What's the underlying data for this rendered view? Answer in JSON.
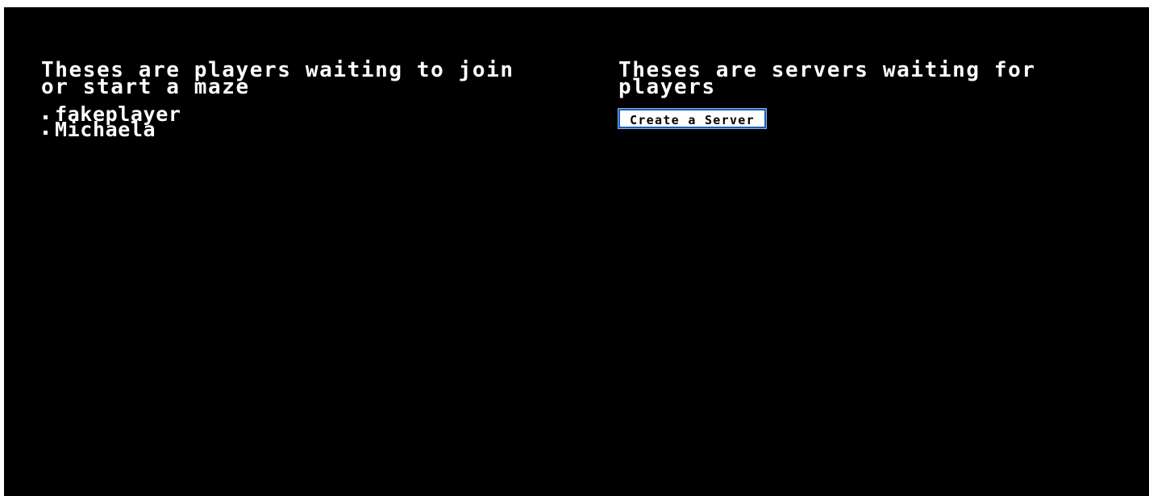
{
  "players_panel": {
    "heading": "Theses are players waiting to join or start a maze",
    "players": [
      {
        "name": "fakeplayer"
      },
      {
        "name": "Michaela"
      }
    ]
  },
  "servers_panel": {
    "heading": "Theses are servers waiting for players",
    "create_button_label": "Create a Server"
  },
  "colors": {
    "background": "#000000",
    "text": "#ffffff",
    "button_border": "#1a5fb4"
  }
}
